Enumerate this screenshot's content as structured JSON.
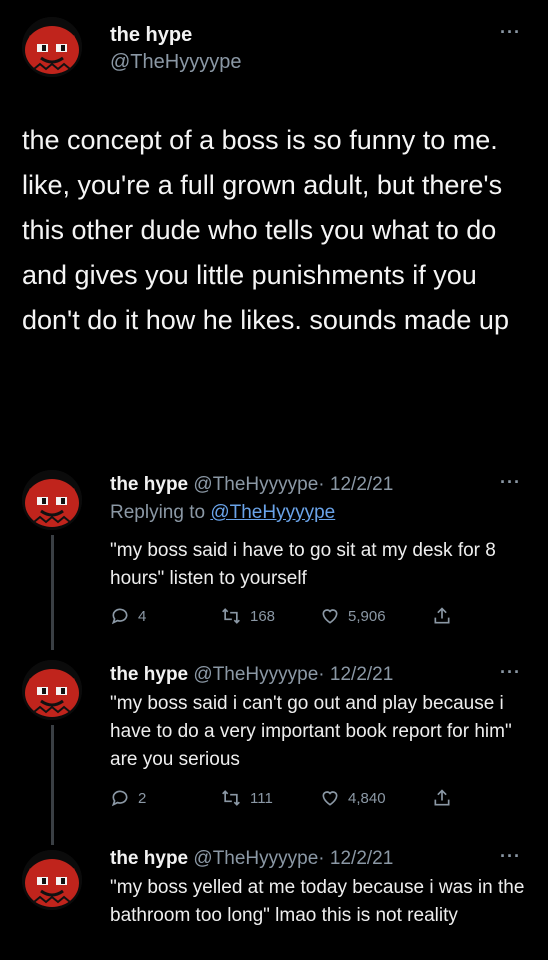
{
  "main_tweet": {
    "name": "the hype",
    "handle": "@TheHyyyype",
    "more": "···",
    "text": "the concept of a boss is so funny to me. like, you're a full grown adult, but there's this other dude who tells you what to do and gives you little punishments if you don't do it how he likes. sounds made up"
  },
  "replies": [
    {
      "name": "the hype",
      "handle": "@TheHyyyype",
      "date": "· 12/2/21",
      "more": "···",
      "replying_prefix": "Replying to ",
      "replying_handle": "@TheHyyyype",
      "text": "\"my boss said i have to go sit at my desk for 8 hours\" listen to yourself",
      "replies_count": "4",
      "retweets_count": "168",
      "likes_count": "5,906"
    },
    {
      "name": "the hype",
      "handle": "@TheHyyyype",
      "date": "· 12/2/21",
      "more": "···",
      "text": "\"my boss said i can't go out and play because i have to do a very important book report for him\" are you serious",
      "replies_count": "2",
      "retweets_count": "111",
      "likes_count": "4,840"
    },
    {
      "name": "the hype",
      "handle": "@TheHyyyype",
      "date": "· 12/2/21",
      "more": "···",
      "text": "\"my boss yelled at me today because i was in the bathroom too long\" lmao this is not reality"
    }
  ],
  "icons": {
    "avatar": "red-devil-face-avatar",
    "reply": "reply-icon",
    "retweet": "retweet-icon",
    "like": "heart-icon",
    "share": "share-icon"
  },
  "colors": {
    "background": "#000000",
    "text": "#e7e9ea",
    "secondary": "#8b98a5",
    "link": "#6aa3e8",
    "avatar_red": "#c0241c"
  }
}
